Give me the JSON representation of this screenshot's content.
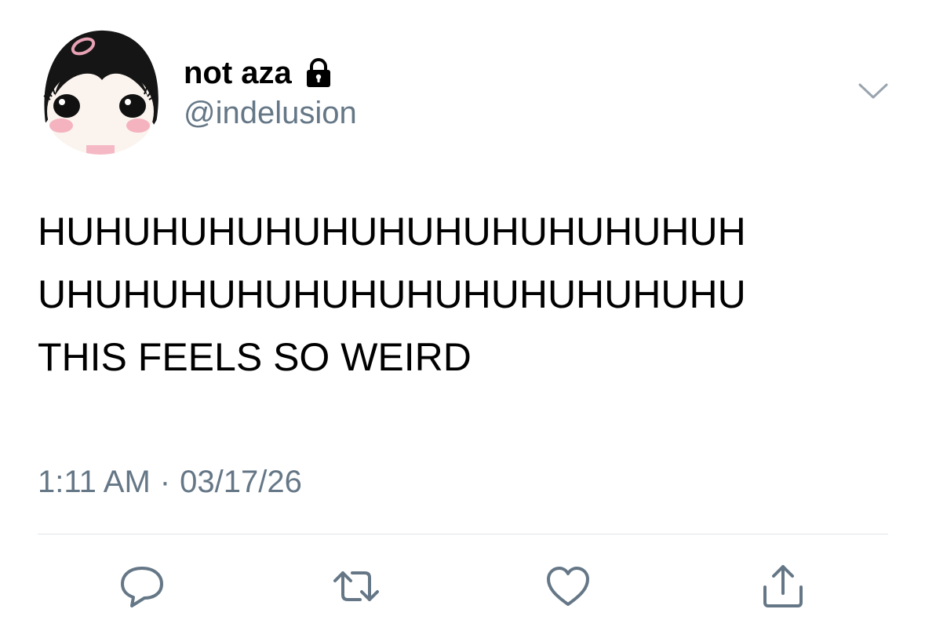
{
  "user": {
    "display_name": "not aza",
    "handle": "@indelusion",
    "protected_icon": "lock-icon",
    "avatar_icon": "cartoon-girl-avatar"
  },
  "tweet": {
    "lines": [
      "HUHUHUHUHUHUHUHUHUHUHUHUH",
      "UHUHUHUHUHUHUHUHUHUHUHUHU",
      "THIS FEELS SO WEIRD"
    ],
    "time": "1:11 AM",
    "separator": "·",
    "date": "03/17/26"
  },
  "menu": {
    "icon": "chevron-down-icon"
  },
  "actions": [
    {
      "name": "reply",
      "icon": "reply-icon"
    },
    {
      "name": "retweet",
      "icon": "retweet-icon"
    },
    {
      "name": "like",
      "icon": "heart-icon"
    },
    {
      "name": "share",
      "icon": "share-icon"
    }
  ],
  "colors": {
    "text": "#000000",
    "secondary": "#657786",
    "divider": "#dfe4e8",
    "icon": "#657786"
  }
}
